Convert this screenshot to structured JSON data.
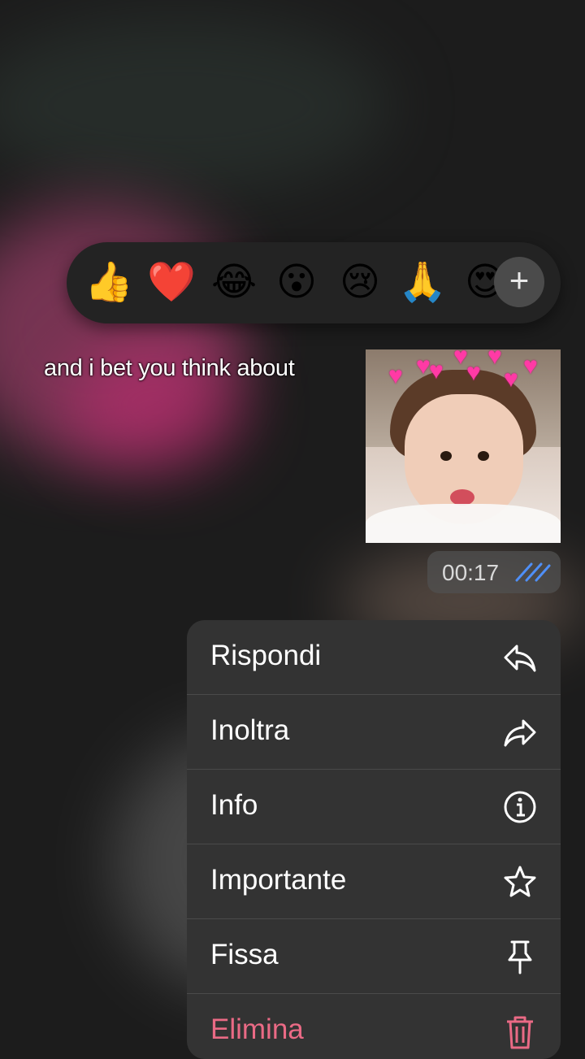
{
  "reactions": {
    "emojis": [
      "👍",
      "❤️",
      "😂",
      "😮",
      "😢",
      "🙏",
      "😍"
    ],
    "more_label": "+"
  },
  "caption": "and i bet you think about",
  "message": {
    "time": "00:17",
    "read_status_icon": "double-check-icon",
    "accent_color": "#4f8ff7"
  },
  "menu": {
    "items": [
      {
        "label": "Rispondi",
        "icon": "reply-icon"
      },
      {
        "label": "Inoltra",
        "icon": "forward-icon"
      },
      {
        "label": "Info",
        "icon": "info-icon"
      },
      {
        "label": "Importante",
        "icon": "star-icon"
      },
      {
        "label": "Fissa",
        "icon": "pin-icon"
      },
      {
        "label": "Elimina",
        "icon": "trash-icon"
      }
    ],
    "danger_color": "#ea6a85"
  }
}
